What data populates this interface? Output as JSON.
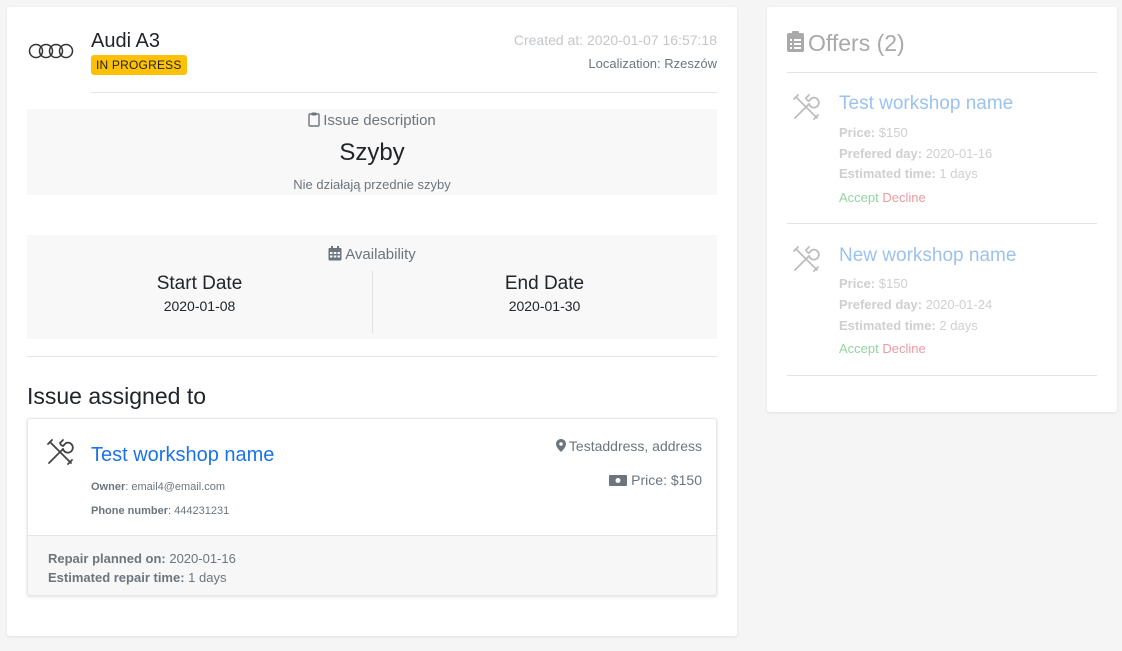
{
  "issue": {
    "car_name": "Audi A3",
    "status": "IN PROGRESS",
    "created_at": "Created at: 2020-01-07 16:57:18",
    "localization": "Localization: Rzeszów",
    "description_heading": "Issue description",
    "title": "Szyby",
    "description": "Nie działają przednie szyby",
    "availability_heading": "Availability",
    "start_label": "Start Date",
    "start_value": "2020-01-08",
    "end_label": "End Date",
    "end_value": "2020-01-30"
  },
  "assigned": {
    "heading": "Issue assigned to",
    "workshop_name": "Test workshop name",
    "owner_label": "Owner",
    "owner_value": ": email4@email.com",
    "phone_label": "Phone number",
    "phone_value": ": 444231231",
    "address": "Testaddress, address",
    "price": "Price: $150",
    "repair_planned_label": "Repair planned on:",
    "repair_planned_value": " 2020-01-16",
    "estimated_label": "Estimated repair time:",
    "estimated_value": " 1 days"
  },
  "offers": {
    "title": "Offers (2)",
    "items": [
      {
        "name": "Test workshop name",
        "price_label": "Price:",
        "price_value": " $150",
        "day_label": "Prefered day:",
        "day_value": " 2020-01-16",
        "time_label": "Estimated time:",
        "time_value": " 1 days",
        "accept": "Accept",
        "decline": "Decline"
      },
      {
        "name": "New workshop name",
        "price_label": "Price:",
        "price_value": " $150",
        "day_label": "Prefered day:",
        "day_value": " 2020-01-24",
        "time_label": "Estimated time:",
        "time_value": " 2 days",
        "accept": "Accept",
        "decline": "Decline"
      }
    ]
  },
  "colors": {
    "status_badge": "#ffc107",
    "link": "#1a73e8",
    "accept": "#94d3a1",
    "decline": "#ec9aa1"
  }
}
